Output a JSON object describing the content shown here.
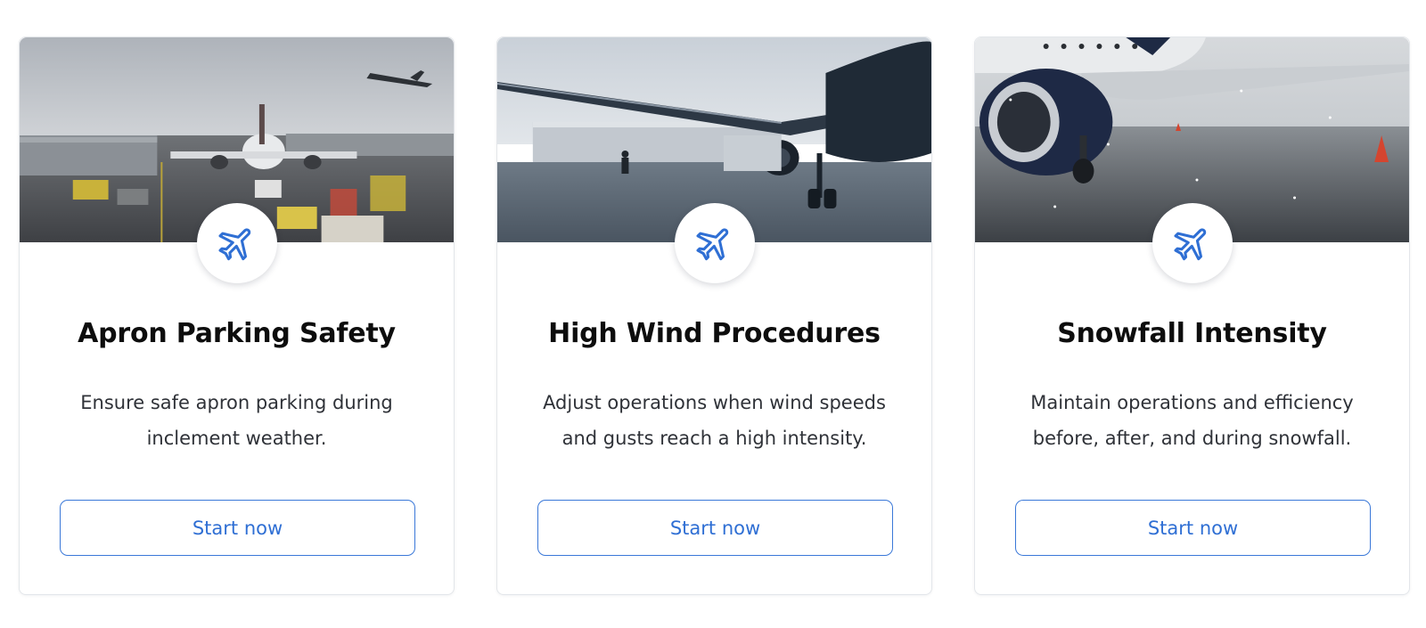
{
  "cards": [
    {
      "title": "Apron Parking Safety",
      "description": "Ensure safe apron parking during inclement weather.",
      "button_label": "Start now",
      "icon": "airplane-icon",
      "image": "apron-parking-photo"
    },
    {
      "title": "High Wind Procedures",
      "description": "Adjust operations when wind speeds and gusts reach a high intensity.",
      "button_label": "Start now",
      "icon": "airplane-icon",
      "image": "high-wind-photo"
    },
    {
      "title": "Snowfall Intensity",
      "description": "Maintain operations and efficiency before, after, and during snowfall.",
      "button_label": "Start now",
      "icon": "airplane-icon",
      "image": "snowfall-photo"
    }
  ],
  "colors": {
    "accent": "#2f6fd4",
    "title": "#0d0d0d",
    "text": "#2f3238",
    "border": "#e3e6ea"
  }
}
